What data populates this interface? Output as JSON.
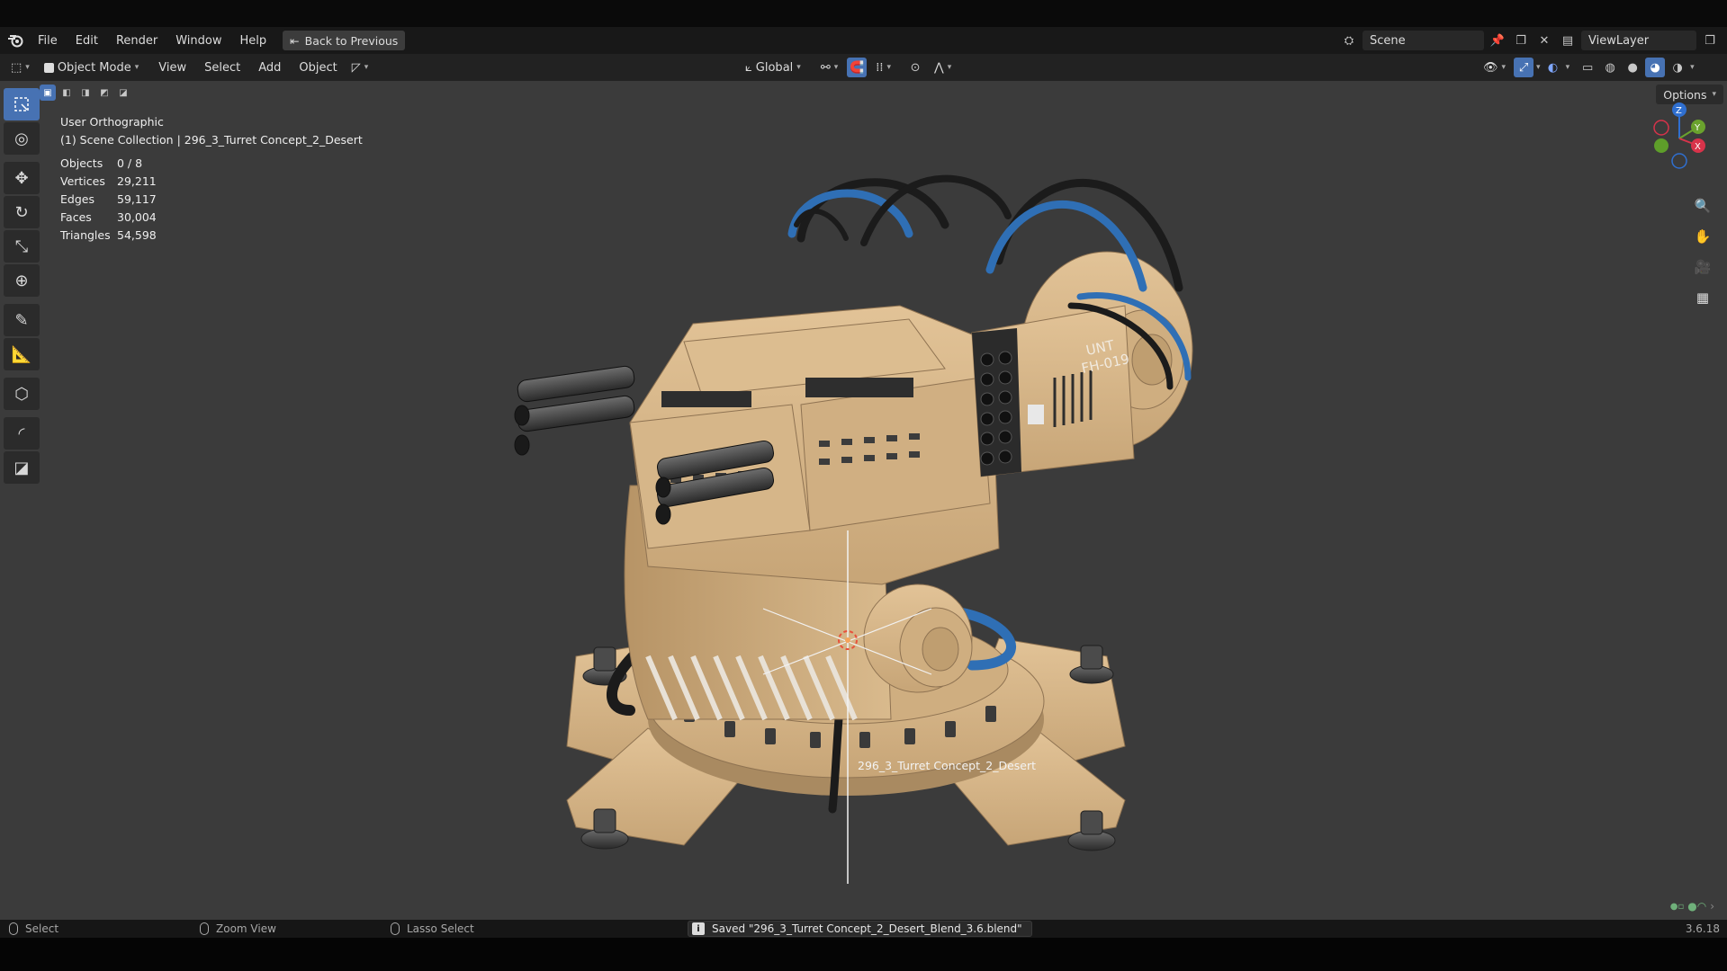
{
  "menubar": {
    "blender_logo": "blender-logo",
    "items": [
      "File",
      "Edit",
      "Render",
      "Window",
      "Help"
    ],
    "back_button": "Back to Previous",
    "scene_label": "Scene",
    "viewlayer_label": "ViewLayer"
  },
  "header": {
    "mode": "Object Mode",
    "menus": [
      "View",
      "Select",
      "Add",
      "Object"
    ],
    "transform_orientation": "Global",
    "options_label": "Options"
  },
  "overlay": {
    "view_name": "User Orthographic",
    "collection": "(1) Scene Collection | 296_3_Turret Concept_2_Desert",
    "stats": [
      {
        "label": "Objects",
        "value": "0 / 8"
      },
      {
        "label": "Vertices",
        "value": "29,211"
      },
      {
        "label": "Edges",
        "value": "59,117"
      },
      {
        "label": "Faces",
        "value": "30,004"
      },
      {
        "label": "Triangles",
        "value": "54,598"
      }
    ]
  },
  "gizmo": {
    "x_label": "X",
    "y_label": "Y",
    "z_label": "Z"
  },
  "viewport": {
    "object_label": "296_3_Turret Concept_2_Desert",
    "decal_text_1": "UNT",
    "decal_text_2": "FH-019"
  },
  "statusbar": {
    "select": "Select",
    "zoom_view": "Zoom View",
    "lasso_select": "Lasso Select",
    "message": "Saved \"296_3_Turret Concept_2_Desert_Blend_3.6.blend\"",
    "version": "3.6.18"
  },
  "colors": {
    "accent": "#4772b3",
    "viewport_bg": "#3b3b3b",
    "model_tan": "#d4b48a",
    "cable_blue": "#2f6fb5"
  }
}
